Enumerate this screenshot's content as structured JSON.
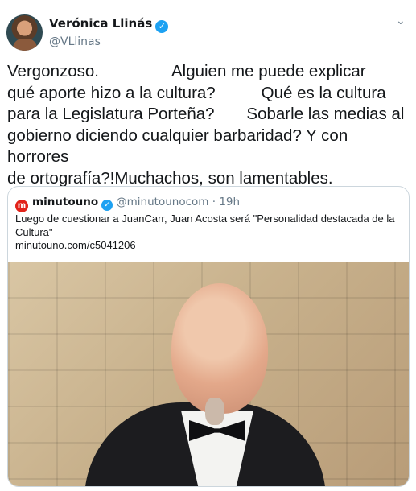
{
  "author": {
    "name": "Verónica Llinás",
    "handle": "@VLlinas",
    "verified": true
  },
  "tweet_text": "Vergonzoso.                Alguien me puede explicar\nqué aporte hizo a la cultura?          Qué es la cultura\npara la Legislatura Porteña?       Sobarle las medias al\ngobierno diciendo cualquier barbaridad? Y con horrores\nde ortografía?!Muchachos, son lamentables.",
  "quoted": {
    "logo_letter": "m",
    "name": "minutouno",
    "verified": true,
    "handle": "@minutounocom",
    "separator": "·",
    "time": "19h",
    "text": "Luego de cuestionar a JuanCarr, Juan Acosta será \"Personalidad destacada de la Cultura\"",
    "link": "minutouno.com/c5041206"
  },
  "icons": {
    "verified": "verified-badge-icon",
    "more": "chevron-down-icon"
  },
  "colors": {
    "accent": "#1da1f2",
    "secondary_text": "#657786",
    "border": "#ccd6dd",
    "minutouno_red": "#e2231a"
  }
}
